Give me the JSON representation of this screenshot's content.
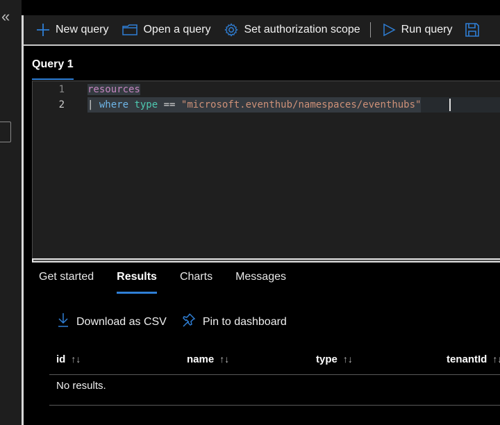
{
  "sidebar": {
    "collapse_icon": "double-chevron-left-icon",
    "collapse_glyph": "«"
  },
  "toolbar": {
    "new_query": {
      "label": "New query",
      "icon": "plus-icon"
    },
    "open_query": {
      "label": "Open a query",
      "icon": "folder-icon"
    },
    "set_scope": {
      "label": "Set authorization scope",
      "icon": "gear-icon"
    },
    "run_query": {
      "label": "Run query",
      "icon": "play-icon"
    },
    "save": {
      "icon": "save-icon"
    }
  },
  "query_tab": {
    "label": "Query 1"
  },
  "editor": {
    "lines": [
      {
        "number": "1",
        "tokens": [
          {
            "text": "resources",
            "kind": "table"
          }
        ]
      },
      {
        "number": "2",
        "tokens": [
          {
            "text": "| ",
            "kind": "pipe"
          },
          {
            "text": "where",
            "kind": "keyword"
          },
          {
            "text": " ",
            "kind": "space"
          },
          {
            "text": "type",
            "kind": "column"
          },
          {
            "text": " == ",
            "kind": "operator"
          },
          {
            "text": "\"microsoft.eventhub/namespaces/eventhubs\"",
            "kind": "string"
          }
        ]
      }
    ]
  },
  "result_tabs": [
    {
      "label": "Get started",
      "active": false
    },
    {
      "label": "Results",
      "active": true
    },
    {
      "label": "Charts",
      "active": false
    },
    {
      "label": "Messages",
      "active": false
    }
  ],
  "actions": {
    "download": {
      "label": "Download as CSV",
      "icon": "download-icon"
    },
    "pin": {
      "label": "Pin to dashboard",
      "icon": "pin-icon"
    }
  },
  "grid": {
    "columns": [
      {
        "label": "id",
        "sort_glyph": "↑↓"
      },
      {
        "label": "name",
        "sort_glyph": "↑↓"
      },
      {
        "label": "type",
        "sort_glyph": "↑↓"
      },
      {
        "label": "tenantId",
        "sort_glyph": "↑↓"
      }
    ],
    "empty_message": "No results."
  },
  "colors": {
    "accent": "#2f7fd6",
    "table_token": "#c586c0",
    "keyword_token": "#6fb6e8",
    "column_token": "#4ec9b0",
    "string_token": "#ce9178"
  }
}
